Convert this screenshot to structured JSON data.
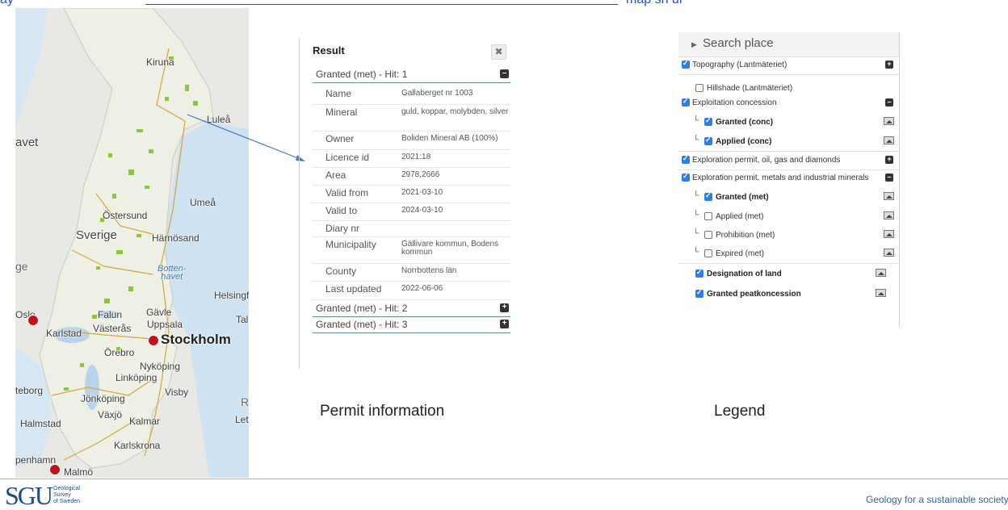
{
  "top_line": {
    "prefix": "ay",
    "suffix": "map sh ur"
  },
  "map": {
    "labels": {
      "kiruna": "Kiruna",
      "lulea": "Luleå",
      "havet": "avet",
      "umea": "Umeå",
      "ostersund": "Östersund",
      "sverige": "Sverige",
      "harnosand": "Härnösand",
      "ge": "ge",
      "bottenhavet": "Botten-\nhavet",
      "falun": "Falun",
      "gavle": "Gävle",
      "helsingf": "Helsingf",
      "oslo": "Oslo",
      "karlstad": "Karlstad",
      "vasteras": "Västerås",
      "uppsala": "Uppsala",
      "tall": "Tall",
      "stockholm": "Stockholm",
      "orebro": "Örebro",
      "nykoping": "Nyköping",
      "linkoping": "Linköping",
      "teborg": "teborg",
      "jonkoping": "Jönköping",
      "visby": "Visby",
      "r": "R",
      "halmstad": "Halmstad",
      "vaxjo": "Växjö",
      "kalmar": "Kalmar",
      "lett": "Lettl",
      "karlskrona": "Karlskrona",
      "penhamn": "penhamn",
      "malmo": "Malmö"
    }
  },
  "result": {
    "title": "Result",
    "hit1": "Granted (met) - Hit: 1",
    "hit2": "Granted (met) - Hit: 2",
    "hit3": "Granted (met) - Hit: 3",
    "rows": [
      {
        "key": "Name",
        "value": "Gallaberget nr 1003"
      },
      {
        "key": "Mineral",
        "value": "guld, koppar, molybden, silver"
      },
      {
        "key": "Owner",
        "value": "Boliden Mineral AB (100%)"
      },
      {
        "key": "Licence id",
        "value": "2021:18"
      },
      {
        "key": "Area",
        "value": "2978,2666"
      },
      {
        "key": "Valid from",
        "value": "2021-03-10"
      },
      {
        "key": "Valid to",
        "value": "2024-03-10"
      },
      {
        "key": "Diary nr",
        "value": ""
      },
      {
        "key": "Municipality",
        "value": "Gällivare kommun, Bodens kommun"
      },
      {
        "key": "County",
        "value": "Norrbottens län"
      },
      {
        "key": "Last updated",
        "value": "2022-06-06"
      }
    ]
  },
  "captions": {
    "permit": "Permit information",
    "legend": "Legend"
  },
  "legend": {
    "search": "Search place",
    "items": [
      {
        "label": "Topography (Lantmäteriet)",
        "checked": true
      },
      {
        "label": "Hillshade (Lantmäteriet)",
        "checked": false
      },
      {
        "label": "Exploitation concession",
        "checked": true
      },
      {
        "label": "Granted (conc)",
        "checked": true
      },
      {
        "label": "Applied (conc)",
        "checked": true
      },
      {
        "label": "Exploration permit, oil, gas and diamonds",
        "checked": true
      },
      {
        "label": "Exploration permit, metals and industrial minerals",
        "checked": true
      },
      {
        "label": "Granted (met)",
        "checked": true
      },
      {
        "label": "Applied (met)",
        "checked": false
      },
      {
        "label": "Prohibition (met)",
        "checked": false
      },
      {
        "label": "Expired (met)",
        "checked": false
      },
      {
        "label": "Designation of land",
        "checked": true
      },
      {
        "label": "Granted peatkoncession",
        "checked": true
      }
    ]
  },
  "footer": {
    "logo": "SGU",
    "logo_sub": "Geological\nSurvey\nof Sweden",
    "tagline": "Geology for a sustainable society"
  },
  "colors": {
    "accent": "#2f7fe0",
    "link": "#1f4fd1",
    "city": "#c0141a",
    "deposit": "#8cc63f"
  }
}
